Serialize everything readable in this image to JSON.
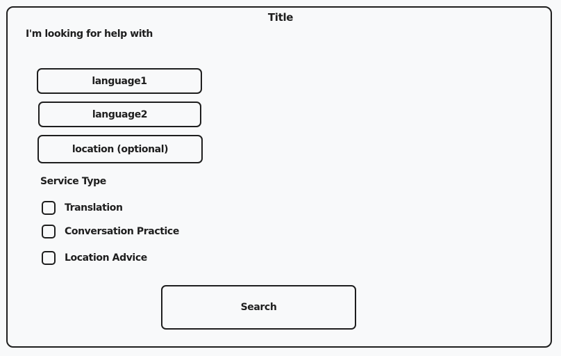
{
  "page": {
    "title": "Title",
    "prompt": "I'm looking for help with"
  },
  "fields": {
    "language1": "language1",
    "language2": "language2",
    "location": "location (optional)"
  },
  "service": {
    "heading": "Service Type",
    "options": [
      {
        "label": "Translation",
        "checked": false
      },
      {
        "label": "Conversation Practice",
        "checked": false
      },
      {
        "label": "Location Advice",
        "checked": false
      }
    ]
  },
  "actions": {
    "search_label": "Search"
  }
}
